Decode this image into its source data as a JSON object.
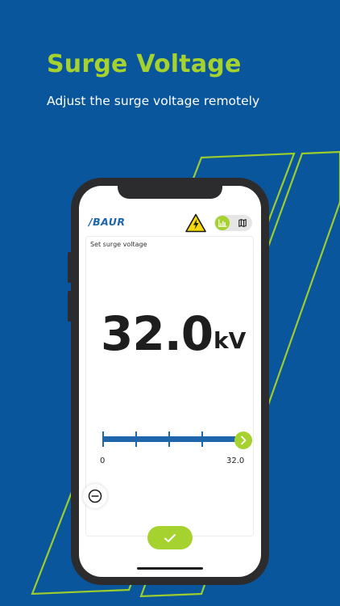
{
  "promo": {
    "headline": "Surge Voltage",
    "subline": "Adjust the surge voltage remotely"
  },
  "app": {
    "logo_text": "/BAUR",
    "warning_icon": "high-voltage-warning-icon",
    "view_toggle": {
      "options": [
        "chart-icon",
        "map-icon"
      ],
      "active": "chart-icon"
    },
    "surge_card": {
      "label": "Set surge voltage",
      "value": "32.0",
      "unit": "kV",
      "slider": {
        "min_label": "0",
        "max_label": "32.0",
        "fraction": 1.0
      }
    },
    "buttons": {
      "decrease_icon": "minus-circle-icon",
      "confirm_icon": "check-icon"
    }
  },
  "colors": {
    "background": "#0a569d",
    "accent_green": "#a6d22f",
    "brand_blue": "#1f65ab",
    "warning_yellow": "#f5d90a"
  }
}
